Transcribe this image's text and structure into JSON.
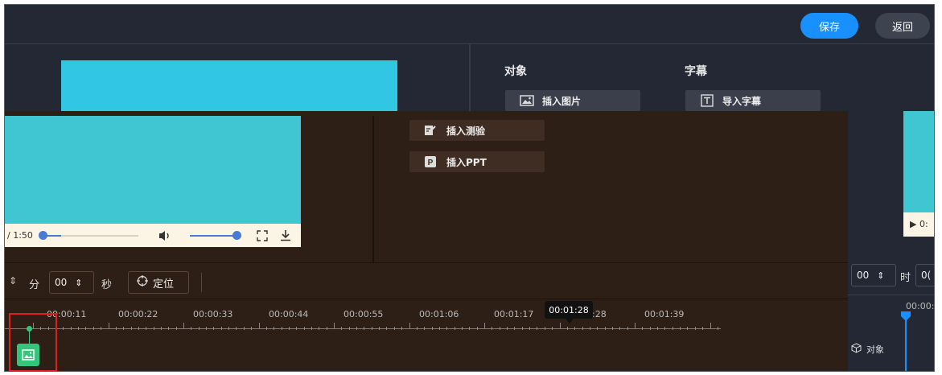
{
  "header": {
    "save_label": "保存",
    "back_label": "返回"
  },
  "panel": {
    "objects_title": "对象",
    "subtitles_title": "字幕",
    "insert_image_label": "插入图片",
    "import_subtitles_label": "导入字幕",
    "insert_quiz_label": "插入测验",
    "insert_ppt_label": "插入PPT"
  },
  "player": {
    "time_text": "/ 1:50",
    "play_text": "▶ 0:"
  },
  "time_controls": {
    "minutes_value": "00",
    "minutes_unit": "分",
    "seconds_value": "00",
    "seconds_unit": "秒",
    "locate_label": "定位",
    "right_value": "00",
    "right_unit": "时",
    "right_value2": "0("
  },
  "timeline": {
    "ruler_labels": [
      "00:00:11",
      "00:00:22",
      "00:00:33",
      "00:00:44",
      "00:00:55",
      "00:01:06",
      "00:01:17",
      "00:01:28",
      "00:01:39"
    ],
    "right_ruler_label": "00:00:0",
    "tooltip": "00:01:28",
    "track_label": "对象"
  },
  "colors": {
    "accent": "#1890ff",
    "track_icon": "#34c47c",
    "highlight": "#e02020"
  }
}
